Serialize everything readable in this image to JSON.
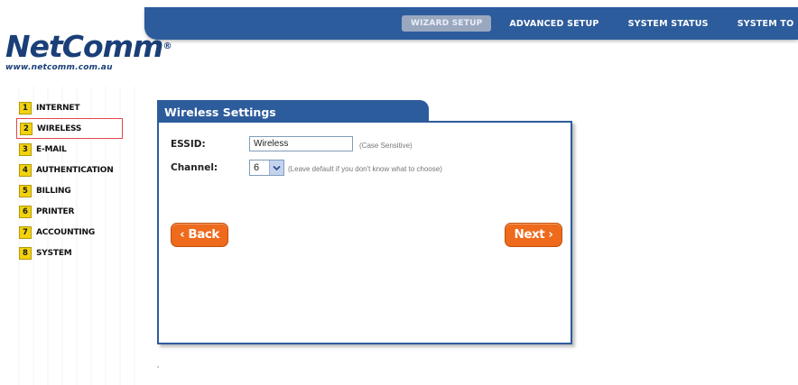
{
  "header": {
    "tabs": [
      {
        "label": "WIZARD SETUP",
        "active": true
      },
      {
        "label": "ADVANCED SETUP",
        "active": false
      },
      {
        "label": "SYSTEM STATUS",
        "active": false
      },
      {
        "label": "SYSTEM TO",
        "active": false
      }
    ]
  },
  "logo": {
    "brand": "NetComm",
    "registered": "®",
    "url": "www.netcomm.com.au"
  },
  "sidebar": {
    "items": [
      {
        "number": "1",
        "label": "INTERNET",
        "selected": false
      },
      {
        "number": "2",
        "label": "WIRELESS",
        "selected": true
      },
      {
        "number": "3",
        "label": "E-MAIL",
        "selected": false
      },
      {
        "number": "4",
        "label": "AUTHENTICATION",
        "selected": false
      },
      {
        "number": "5",
        "label": "BILLING",
        "selected": false
      },
      {
        "number": "6",
        "label": "PRINTER",
        "selected": false
      },
      {
        "number": "7",
        "label": "ACCOUNTING",
        "selected": false
      },
      {
        "number": "8",
        "label": "SYSTEM",
        "selected": false
      }
    ]
  },
  "panel": {
    "title": "Wireless Settings",
    "essid": {
      "label": "ESSID:",
      "value": "Wireless",
      "hint": "(Case Sensitive)"
    },
    "channel": {
      "label": "Channel:",
      "value": "6",
      "hint": "(Leave default if you don't know what to choose)"
    },
    "back_label": "‹ Back",
    "next_label": "Next ›"
  },
  "colors": {
    "header_blue": "#2d5c9c",
    "button_orange": "#ee6a1c",
    "number_yellow": "#f2d20d",
    "selection_red": "#e2474c"
  }
}
